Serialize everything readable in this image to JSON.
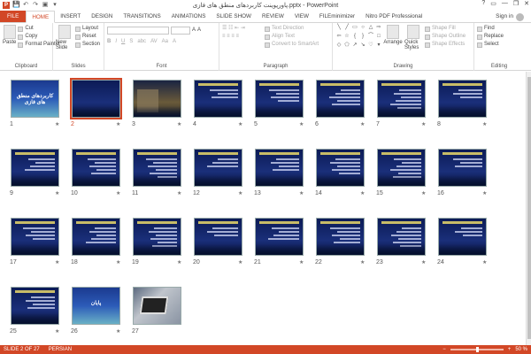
{
  "window": {
    "title": "پاورپوینت کاربردهای منطق های فازی.pptx - PowerPoint",
    "qat": [
      "P",
      "💾",
      "↶",
      "↷",
      "▣",
      "▾"
    ],
    "controls": [
      "?",
      "▭",
      "—",
      "❐",
      "✕"
    ]
  },
  "tabs": [
    {
      "label": "FILE"
    },
    {
      "label": "HOME"
    },
    {
      "label": "INSERT"
    },
    {
      "label": "DESIGN"
    },
    {
      "label": "TRANSITIONS"
    },
    {
      "label": "ANIMATIONS"
    },
    {
      "label": "SLIDE SHOW"
    },
    {
      "label": "REVIEW"
    },
    {
      "label": "VIEW"
    },
    {
      "label": "FILEminimizer"
    },
    {
      "label": "Nitro PDF Professional"
    }
  ],
  "signin": "Sign in",
  "ribbon": {
    "clipboard": {
      "paste": "Paste",
      "cut": "Cut",
      "copy": "Copy",
      "format_painter": "Format Painter",
      "label": "Clipboard"
    },
    "slides": {
      "new_slide": "New Slide",
      "layout": "Layout",
      "reset": "Reset",
      "section": "Section",
      "label": "Slides"
    },
    "font": {
      "label": "Font",
      "buttons": [
        "B",
        "I",
        "U",
        "S",
        "abc",
        "AV",
        "Aa",
        "A"
      ]
    },
    "paragraph": {
      "text_direction": "Text Direction",
      "align_text": "Align Text",
      "convert": "Convert to SmartArt",
      "label": "Paragraph"
    },
    "drawing": {
      "arrange": "Arrange",
      "quick_styles": "Quick Styles",
      "shape_fill": "Shape Fill",
      "shape_outline": "Shape Outline",
      "shape_effects": "Shape Effects",
      "label": "Drawing"
    },
    "editing": {
      "find": "Find",
      "replace": "Replace",
      "select": "Select",
      "label": "Editing"
    }
  },
  "slides": [
    {
      "n": "1",
      "title": "کاربردهای منطق های فازی"
    },
    {
      "n": "2"
    },
    {
      "n": "3"
    },
    {
      "n": "4"
    },
    {
      "n": "5"
    },
    {
      "n": "6"
    },
    {
      "n": "7"
    },
    {
      "n": "8"
    },
    {
      "n": "9"
    },
    {
      "n": "10"
    },
    {
      "n": "11"
    },
    {
      "n": "12"
    },
    {
      "n": "13"
    },
    {
      "n": "14"
    },
    {
      "n": "15"
    },
    {
      "n": "16"
    },
    {
      "n": "17"
    },
    {
      "n": "18"
    },
    {
      "n": "19"
    },
    {
      "n": "20"
    },
    {
      "n": "21"
    },
    {
      "n": "22"
    },
    {
      "n": "23"
    },
    {
      "n": "24"
    },
    {
      "n": "25"
    },
    {
      "n": "26",
      "title": "پایان"
    },
    {
      "n": "27"
    }
  ],
  "star": "★",
  "status": {
    "slide": "SLIDE 2 OF 27",
    "lang": "PERSIAN",
    "zoom": "50 %",
    "zoom_fraction": 0.5
  }
}
